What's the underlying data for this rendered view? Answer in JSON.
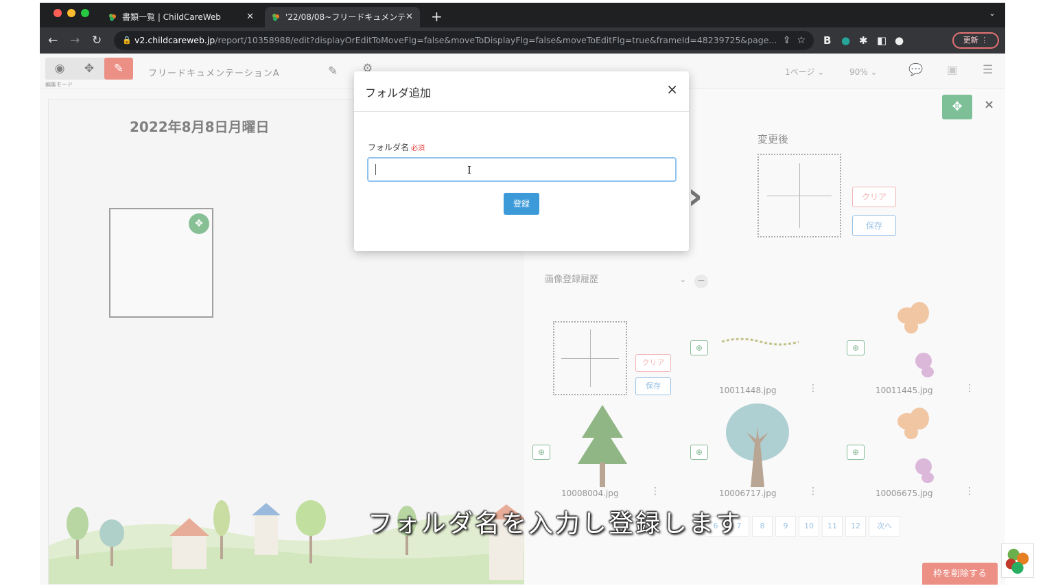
{
  "browser": {
    "tabs": [
      {
        "title": "書類一覧 | ChildCareWeb",
        "active": false
      },
      {
        "title": "'22/08/08~フリードキュメンテ",
        "active": true
      }
    ],
    "url_host": "v2.childcareweb.jp",
    "url_path": "/report/10358988/edit?displayOrEditToMoveFlg=false&moveToDisplayFlg=false&moveToEditFlg=true&frameId=48239725&page...",
    "update_button": "更新"
  },
  "app": {
    "mode_label": "編集モード",
    "doc_title": "フリードキュメンテーションA",
    "page_select": "1ページ",
    "zoom_select": "90%",
    "date": "2022年8月8日月曜日"
  },
  "right_panel": {
    "after_label": "変更後",
    "clear_label": "クリア",
    "save_label": "保存",
    "history_select": "画像登録履歴",
    "images": [
      {
        "name": "10011448.jpg"
      },
      {
        "name": "10011445.jpg"
      },
      {
        "name": "10008004.jpg"
      },
      {
        "name": "10006717.jpg"
      },
      {
        "name": "10006675.jpg"
      }
    ],
    "pages": [
      "6",
      "7",
      "8",
      "9",
      "10",
      "11",
      "12"
    ],
    "next_label": "次へ",
    "delete_label": "枠を削除する"
  },
  "modal": {
    "title": "フォルダ追加",
    "close": "×",
    "field_label": "フォルダ名",
    "required": "必須",
    "input_value": "",
    "submit": "登録"
  },
  "caption": "フォルダ名を入力し登録します",
  "colors": {
    "accent_green": "#2e9a5a",
    "primary_blue": "#3d9ad9",
    "danger_red": "#e04b3b"
  }
}
